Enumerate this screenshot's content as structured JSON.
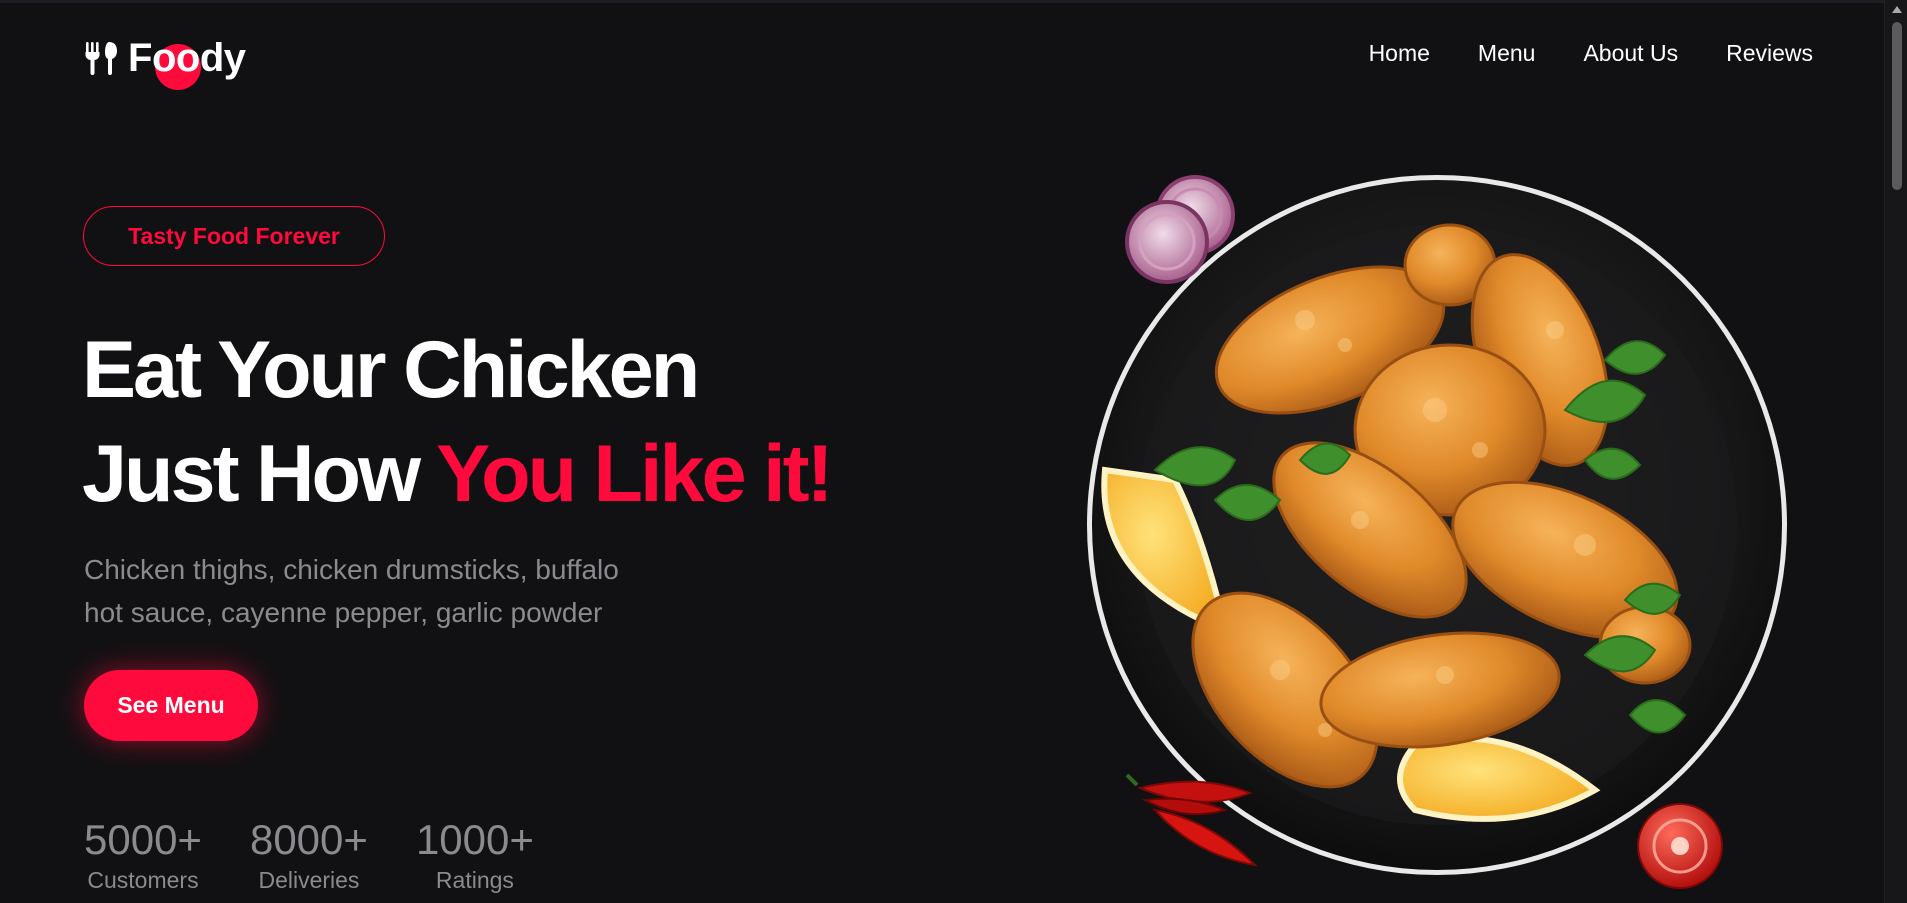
{
  "brand": {
    "name_f": "F",
    "name_oo": "oo",
    "name_dy": "dy",
    "accent": "#ff0a3c"
  },
  "nav": {
    "items": [
      "Home",
      "Menu",
      "About Us",
      "Reviews"
    ]
  },
  "hero": {
    "badge": "Tasty Food Forever",
    "headline_line1": "Eat Your Chicken",
    "headline_line2_a": "Just How ",
    "headline_line2_b": "You Like it!",
    "subtitle_line1": "Chicken thighs, chicken drumsticks, buffalo",
    "subtitle_line2": "hot sauce, cayenne pepper, garlic powder",
    "cta": "See Menu"
  },
  "stats": [
    {
      "value": "5000+",
      "label": "Customers"
    },
    {
      "value": "8000+",
      "label": "Deliveries"
    },
    {
      "value": "1000+",
      "label": "Ratings"
    }
  ],
  "icons": {
    "logo": "fork-spoon-icon",
    "dish": "fried-chicken-plate-image"
  },
  "colors": {
    "background": "#111113",
    "accent": "#ff0a3c",
    "muted": "#8a8a8f"
  }
}
